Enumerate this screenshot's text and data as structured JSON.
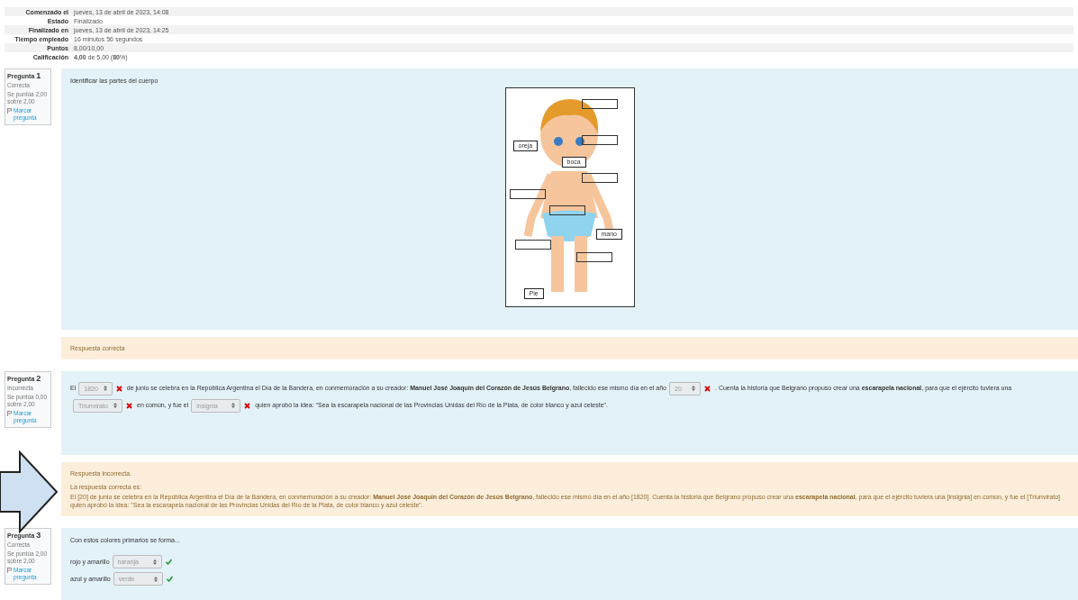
{
  "summary": [
    {
      "label": "Comenzado el",
      "value": "jueves, 13 de abril de 2023, 14:08"
    },
    {
      "label": "Estado",
      "value": "Finalizado"
    },
    {
      "label": "Finalizado en",
      "value": "jueves, 13 de abril de 2023, 14:25"
    },
    {
      "label": "Tiempo empleado",
      "value": "16 minutos 56 segundos"
    },
    {
      "label": "Puntos",
      "value": "8,00/10,00"
    },
    {
      "label": "Calificación",
      "value": "**4,00** de 5,00 (**80**%)"
    }
  ],
  "questions": [
    {
      "kind": "image",
      "label": "Pregunta",
      "number": "1",
      "status": "Correcta",
      "score": "Se puntúa 2,00 sobre 2,00",
      "flag": "Marcar pregunta",
      "prompt": "Identificar las partes del cuerpo",
      "zones": [
        {
          "label": "oreja"
        },
        {
          "label": "boca"
        },
        {
          "label": "mano"
        },
        {
          "label": "Pie"
        }
      ],
      "feedback": [
        "Respuesta correcta"
      ]
    },
    {
      "kind": "cloze",
      "label": "Pregunta",
      "number": "2",
      "status": "Incorrecta",
      "score": "Se puntúa 0,00 sobre 2,00",
      "flag": "Marcar pregunta",
      "parts": [
        {
          "kind": "text",
          "text": "El"
        },
        {
          "kind": "select",
          "value": "1820",
          "correct": false
        },
        {
          "kind": "text",
          "text": "de junio se celebra en la República Argentina el Día de la Bandera, en conmemoración a su creador: **Manuel José Joaquín del Corazón de Jesús Belgrano**, fallecido ese mismo día en el año"
        },
        {
          "kind": "select",
          "value": "20",
          "correct": false
        },
        {
          "kind": "text",
          "text": ". Cuenta la historia que Belgrano propuso crear una **escarapela nacional**, para que el ejército tuviera una"
        },
        {
          "kind": "select",
          "value": "Triunvirato",
          "correct": false
        },
        {
          "kind": "text",
          "text": "en común, y fue el"
        },
        {
          "kind": "select",
          "value": "insignia",
          "correct": false
        },
        {
          "kind": "text",
          "text": "quien aprobó la idea: \"Sea la escarapela nacional de las Provincias Unidas del Río de la Plata, de color blanco y azul celeste\"."
        }
      ],
      "feedback": [
        "Respuesta incorrecta.",
        "La respuesta correcta es:",
        "El [20] de junio se celebra en la República Argentina el Día de la Bandera, en conmemoración a su creador: **Manuel José Joaquín del Corazón de Jesús Belgrano**, fallecido ese mismo día en el año [1820]. Cuenta la historia que Belgrano propuso crear una **escarapela nacional**, para que el ejército tuviera una [insignia] en común, y fue el [Triunvirato] quien aprobó la idea: \"Sea la escarapela nacional de las Provincias Unidas del Río de la Plata, de color blanco y azul celeste\"."
      ]
    },
    {
      "kind": "match",
      "label": "Pregunta",
      "number": "3",
      "status": "Correcta",
      "score": "Se puntúa 2,00 sobre 2,00",
      "flag": "Marcar pregunta",
      "prompt": "Con estos colores primarios se forma...",
      "rows": [
        {
          "text": "rojo y amarillo",
          "value": "naranja",
          "correct": true
        },
        {
          "text": "azul y amarillo",
          "value": "verde",
          "correct": true
        }
      ]
    }
  ]
}
